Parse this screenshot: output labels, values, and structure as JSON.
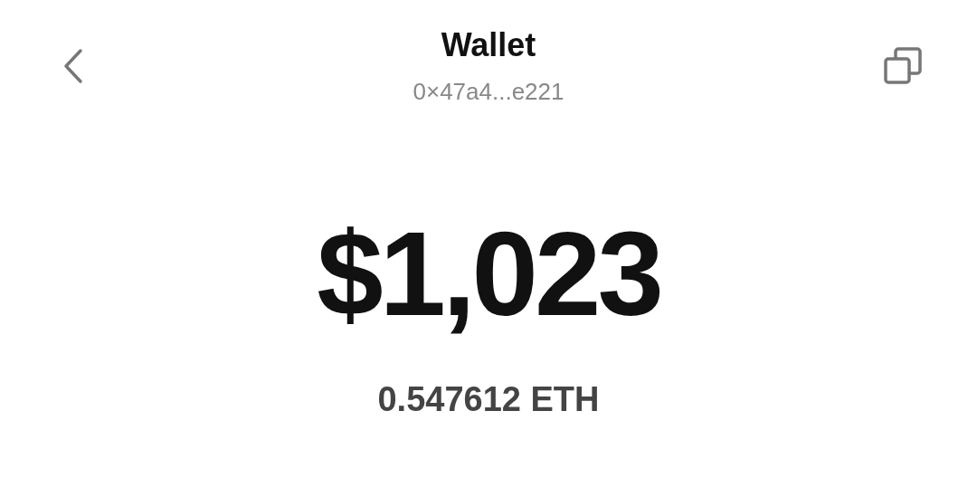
{
  "header": {
    "title": "Wallet",
    "address": "0×47a4...e221"
  },
  "balance": {
    "fiat": "$1,023",
    "crypto": "0.547612 ETH"
  }
}
